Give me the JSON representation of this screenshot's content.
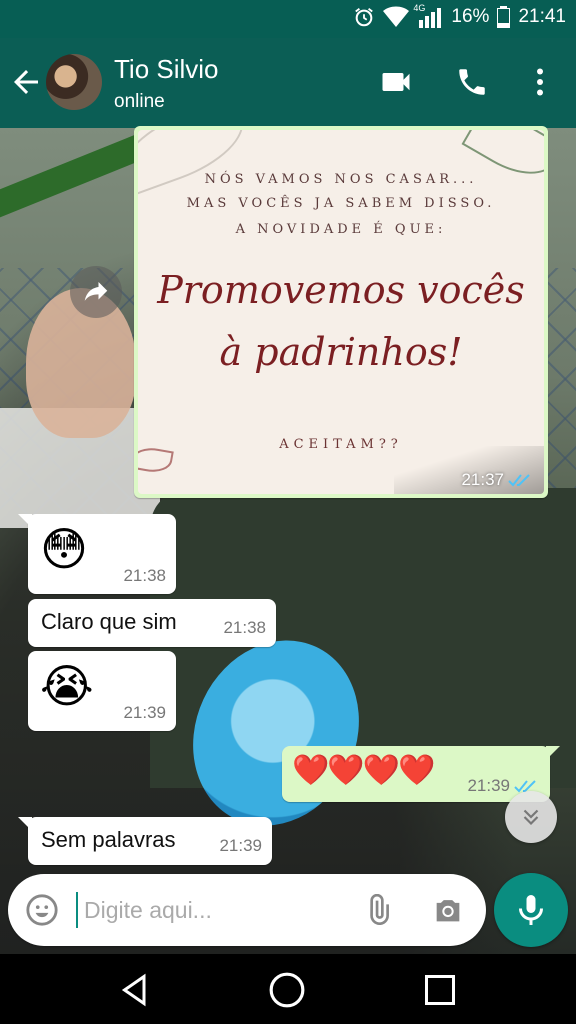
{
  "status_bar": {
    "network": "4G",
    "battery": "16%",
    "time": "21:41"
  },
  "header": {
    "contact_name": "Tio Silvio",
    "status": "online"
  },
  "image_message": {
    "lines": [
      "NÓS VAMOS NOS CASAR...",
      "MAS VOCÊS JA SABEM DISSO.",
      "A NOVIDADE É QUE:"
    ],
    "headline": [
      "Promovemos vocês",
      "à padrinhos!"
    ],
    "question": "ACEITAM??",
    "time": "21:37"
  },
  "messages": [
    {
      "direction": "in",
      "emoji": "😳",
      "time": "21:38"
    },
    {
      "direction": "in",
      "text": "Claro que sim",
      "time": "21:38"
    },
    {
      "direction": "in",
      "emoji": "😭",
      "time": "21:39"
    },
    {
      "direction": "out",
      "emoji": "❤️❤️❤️❤️",
      "time": "21:39"
    },
    {
      "direction": "in",
      "text": "Sem palavras",
      "time": "21:39"
    }
  ],
  "composer": {
    "placeholder": "Digite aqui..."
  },
  "colors": {
    "header": "#0b5e55",
    "status_bar": "#075e54",
    "outgoing_bubble": "#dcf8c6",
    "incoming_bubble": "#ffffff",
    "accent": "#0a8d80",
    "headline": "#7b1f22",
    "read_ticks": "#4fc3f7"
  },
  "icons": {
    "back": "arrow-left-icon",
    "video_call": "video-camera-icon",
    "voice_call": "phone-icon",
    "menu": "more-vert-icon",
    "forward": "forward-icon",
    "scroll_down": "double-chevron-down-icon",
    "emoji": "emoji-smile-icon",
    "attach": "paperclip-icon",
    "camera": "camera-icon",
    "mic": "microphone-icon"
  }
}
